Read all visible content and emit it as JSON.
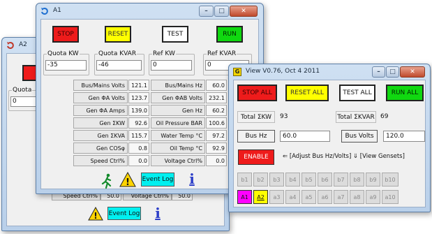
{
  "windows": {
    "a2": {
      "title": "A2",
      "quota_kw_label": "Quota",
      "quota_kw_value": "0",
      "speed_ctrl_label": "Speed Ctrl%",
      "speed_ctrl_value": "50.0",
      "voltage_ctrl_label": "Voltage Ctrl%",
      "voltage_ctrl_value": "50.0",
      "event_log_label": "Event Log",
      "info_label": "i"
    },
    "a1": {
      "title": "A1",
      "controls": {
        "minimize": "–",
        "maximize": "□",
        "close": "✕"
      },
      "buttons": {
        "stop": "STOP",
        "reset": "RESET",
        "test": "TEST",
        "run": "RUN"
      },
      "quotas": [
        {
          "label": "Quota KW",
          "value": "-35"
        },
        {
          "label": "Quota KVAR",
          "value": "-46"
        },
        {
          "label": "Ref KW",
          "value": "0"
        },
        {
          "label": "Ref KVAR",
          "value": "0"
        }
      ],
      "meters_left": [
        {
          "label": "Bus/Mains Volts",
          "value": "121.1"
        },
        {
          "label": "Gen ΦA Volts",
          "value": "123.7"
        },
        {
          "label": "Gen ΦA Amps",
          "value": "139.0"
        },
        {
          "label": "Gen ΣKW",
          "value": "92.6"
        },
        {
          "label": "Gen ΣKVA",
          "value": "115.7"
        },
        {
          "label": "Gen COSφ",
          "value": "0.8"
        },
        {
          "label": "Speed Ctrl%",
          "value": "0.0"
        }
      ],
      "meters_right": [
        {
          "label": "Bus/Mains Hz",
          "value": "60.0"
        },
        {
          "label": "Gen ΦAB Volts",
          "value": "232.1"
        },
        {
          "label": "Gen Hz",
          "value": "60.2"
        },
        {
          "label": "Oil Pressure BAR",
          "value": "100.6"
        },
        {
          "label": "Water Temp °C",
          "value": "97.2"
        },
        {
          "label": "Oil Temp °C",
          "value": "92.9"
        },
        {
          "label": "Voltage Ctrl%",
          "value": "0.0"
        }
      ],
      "event_log_label": "Event Log",
      "info_label": "i"
    },
    "view": {
      "title": "View V0.76, Oct 4 2011",
      "controls": {
        "minimize": "–",
        "maximize": "□",
        "close": "✕"
      },
      "buttons": {
        "stop_all": "STOP ALL",
        "reset_all": "RESET ALL",
        "test_all": "TEST ALL",
        "run_all": "RUN ALL"
      },
      "total_kw_label": "Total ΣKW",
      "total_kw_value": "93",
      "total_kvar_label": "Total ΣKVAR",
      "total_kvar_value": "69",
      "bus_hz_label": "Bus Hz",
      "bus_hz_value": "60.0",
      "bus_volts_label": "Bus Volts",
      "bus_volts_value": "120.0",
      "enable_label": "ENABLE",
      "hint_text": "⇐ [Adjust Bus Hz/Volts] ⇓ [View Gensets]",
      "gensets_b": [
        "b1",
        "b2",
        "b3",
        "b4",
        "b5",
        "b6",
        "b7",
        "b8",
        "b9",
        "b10"
      ],
      "gensets_a": [
        "A1",
        "A2",
        "a3",
        "a4",
        "a5",
        "a6",
        "a7",
        "a8",
        "a9",
        "a10"
      ]
    }
  },
  "colors": {
    "stop": "#ee1b1b",
    "reset": "#ffff00",
    "run": "#10d810",
    "event_log": "#00f0f0",
    "genset_a1": "#ff00ff",
    "genset_a2": "#ffff00"
  }
}
